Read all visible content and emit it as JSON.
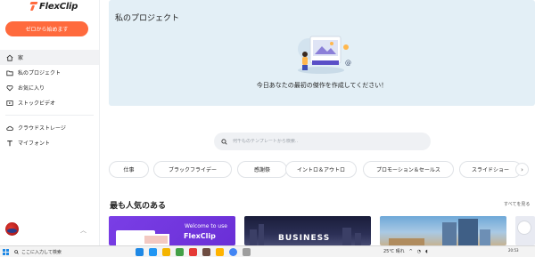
{
  "app": {
    "logo_text": "FlexClip"
  },
  "sidebar": {
    "start_button": "ゼロから始めます",
    "items": [
      {
        "label": "家",
        "icon": "home-icon"
      },
      {
        "label": "私のプロジェクト",
        "icon": "folder-icon"
      },
      {
        "label": "お気に入り",
        "icon": "heart-icon"
      },
      {
        "label": "ストックビデオ",
        "icon": "film-icon"
      },
      {
        "label": "クラウドストレージ",
        "icon": "cloud-icon"
      },
      {
        "label": "マイフォント",
        "icon": "font-icon"
      }
    ],
    "active_index": 0
  },
  "projects": {
    "title": "私のプロジェクト",
    "empty_message": "今日あなたの最初の傑作を作成してください！"
  },
  "search": {
    "placeholder": "何千ものテンプレートから検索.."
  },
  "categories": [
    "仕事",
    "ブラックフライデー",
    "感謝祭",
    "イントロ＆アウトロ",
    "プロモーション＆セールス",
    "スライドショー"
  ],
  "popular": {
    "title": "最も人気のある",
    "see_all": "すべてを見る",
    "thumbnails": [
      {
        "line1": "Welcome to use",
        "line2": "FlexClip"
      },
      {
        "label": "BUSINESS"
      },
      {
        "label": ""
      }
    ]
  },
  "taskbar": {
    "search_text": "ここに入力して検索",
    "tray_text": "25℃ 晴れ",
    "time": "20:53",
    "colors": [
      "#1e88e5",
      "#2196f3",
      "#f4b400",
      "#43a047",
      "#e53935",
      "#6d4c41",
      "#ffb300",
      "#4285f4",
      "#9e9e9e"
    ]
  },
  "colors": {
    "accent": "#ff6a3d",
    "panel": "#e3eff6"
  }
}
